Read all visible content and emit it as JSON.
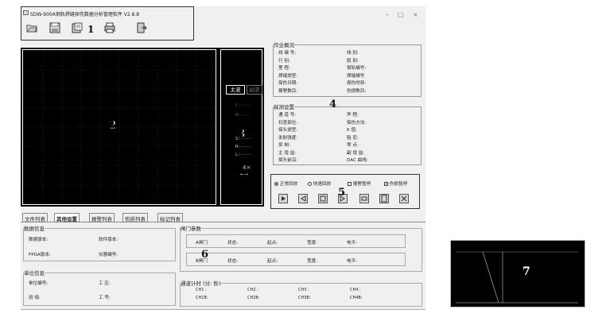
{
  "window": {
    "title": "SDW-900A钢轨焊缝探伤数据分析管理软件 V2.8.8",
    "min": "–",
    "max": "□",
    "close": "×"
  },
  "annotations": [
    "1",
    "2",
    "3",
    "4",
    "5",
    "6",
    "7"
  ],
  "side": {
    "main_wave": "主波",
    "sub_wave": "副波",
    "readings": [
      "C:----",
      "H:----",
      "S:----",
      "H:----",
      "L:----"
    ],
    "zoom": "4×",
    "arrows": "←→"
  },
  "overview": {
    "title": "作业概况",
    "left": [
      "线 编 号:",
      "行    别:",
      "里    程:",
      "焊缝类型:",
      "探伤日期:",
      "报警数目:"
    ],
    "right": [
      "线    别:",
      "股    别:",
      "钢轨编号:",
      "焊缝编号",
      "探伤时刻:",
      "伤损数目:"
    ]
  },
  "detect": {
    "title": "探测设置",
    "left": [
      "通 道 号:",
      "扫查部位:",
      "探头类型:",
      "发射强度:",
      "抑    制:",
      "主 增 益:",
      "探头前沿:"
    ],
    "right": [
      "声    程:",
      "探伤方法:",
      "K    值:",
      "阻    尼:",
      "零    点:",
      "副 增 益:",
      "DAC 曲线:"
    ]
  },
  "playback": {
    "normal": "正常回放",
    "fast": "快速回放",
    "alarm_pause": "报警暂停",
    "damage_pause": "伤损暂停"
  },
  "tabs": [
    "文件列表",
    "其他设置",
    "报警列表",
    "伤损列表",
    "标记列表"
  ],
  "data_info": {
    "title": "数据信息",
    "data_ver": "数据版本:",
    "soft_ver": "软件版本:",
    "fpga_ver": "FPGA版本:",
    "dev_no": "仪器编号:"
  },
  "unit_info": {
    "title": "单位信息",
    "unit_no": "单位编号:",
    "area": "工    区:",
    "team": "班    组:",
    "work_no": "工    号:"
  },
  "gate": {
    "title": "闸门参数",
    "a": "A闸门",
    "b": "B闸门",
    "state": "状态:",
    "start": "起点:",
    "width": "宽度:",
    "level": "电平:"
  },
  "timer": {
    "title": "通道计时 (分: 秒)",
    "row1": [
      "CH1 :",
      "CH2 :",
      "CH3 :",
      "CH4 :"
    ],
    "row2": [
      "CH1B:",
      "CH2B:",
      "CH3B:",
      "CH4B:"
    ]
  }
}
